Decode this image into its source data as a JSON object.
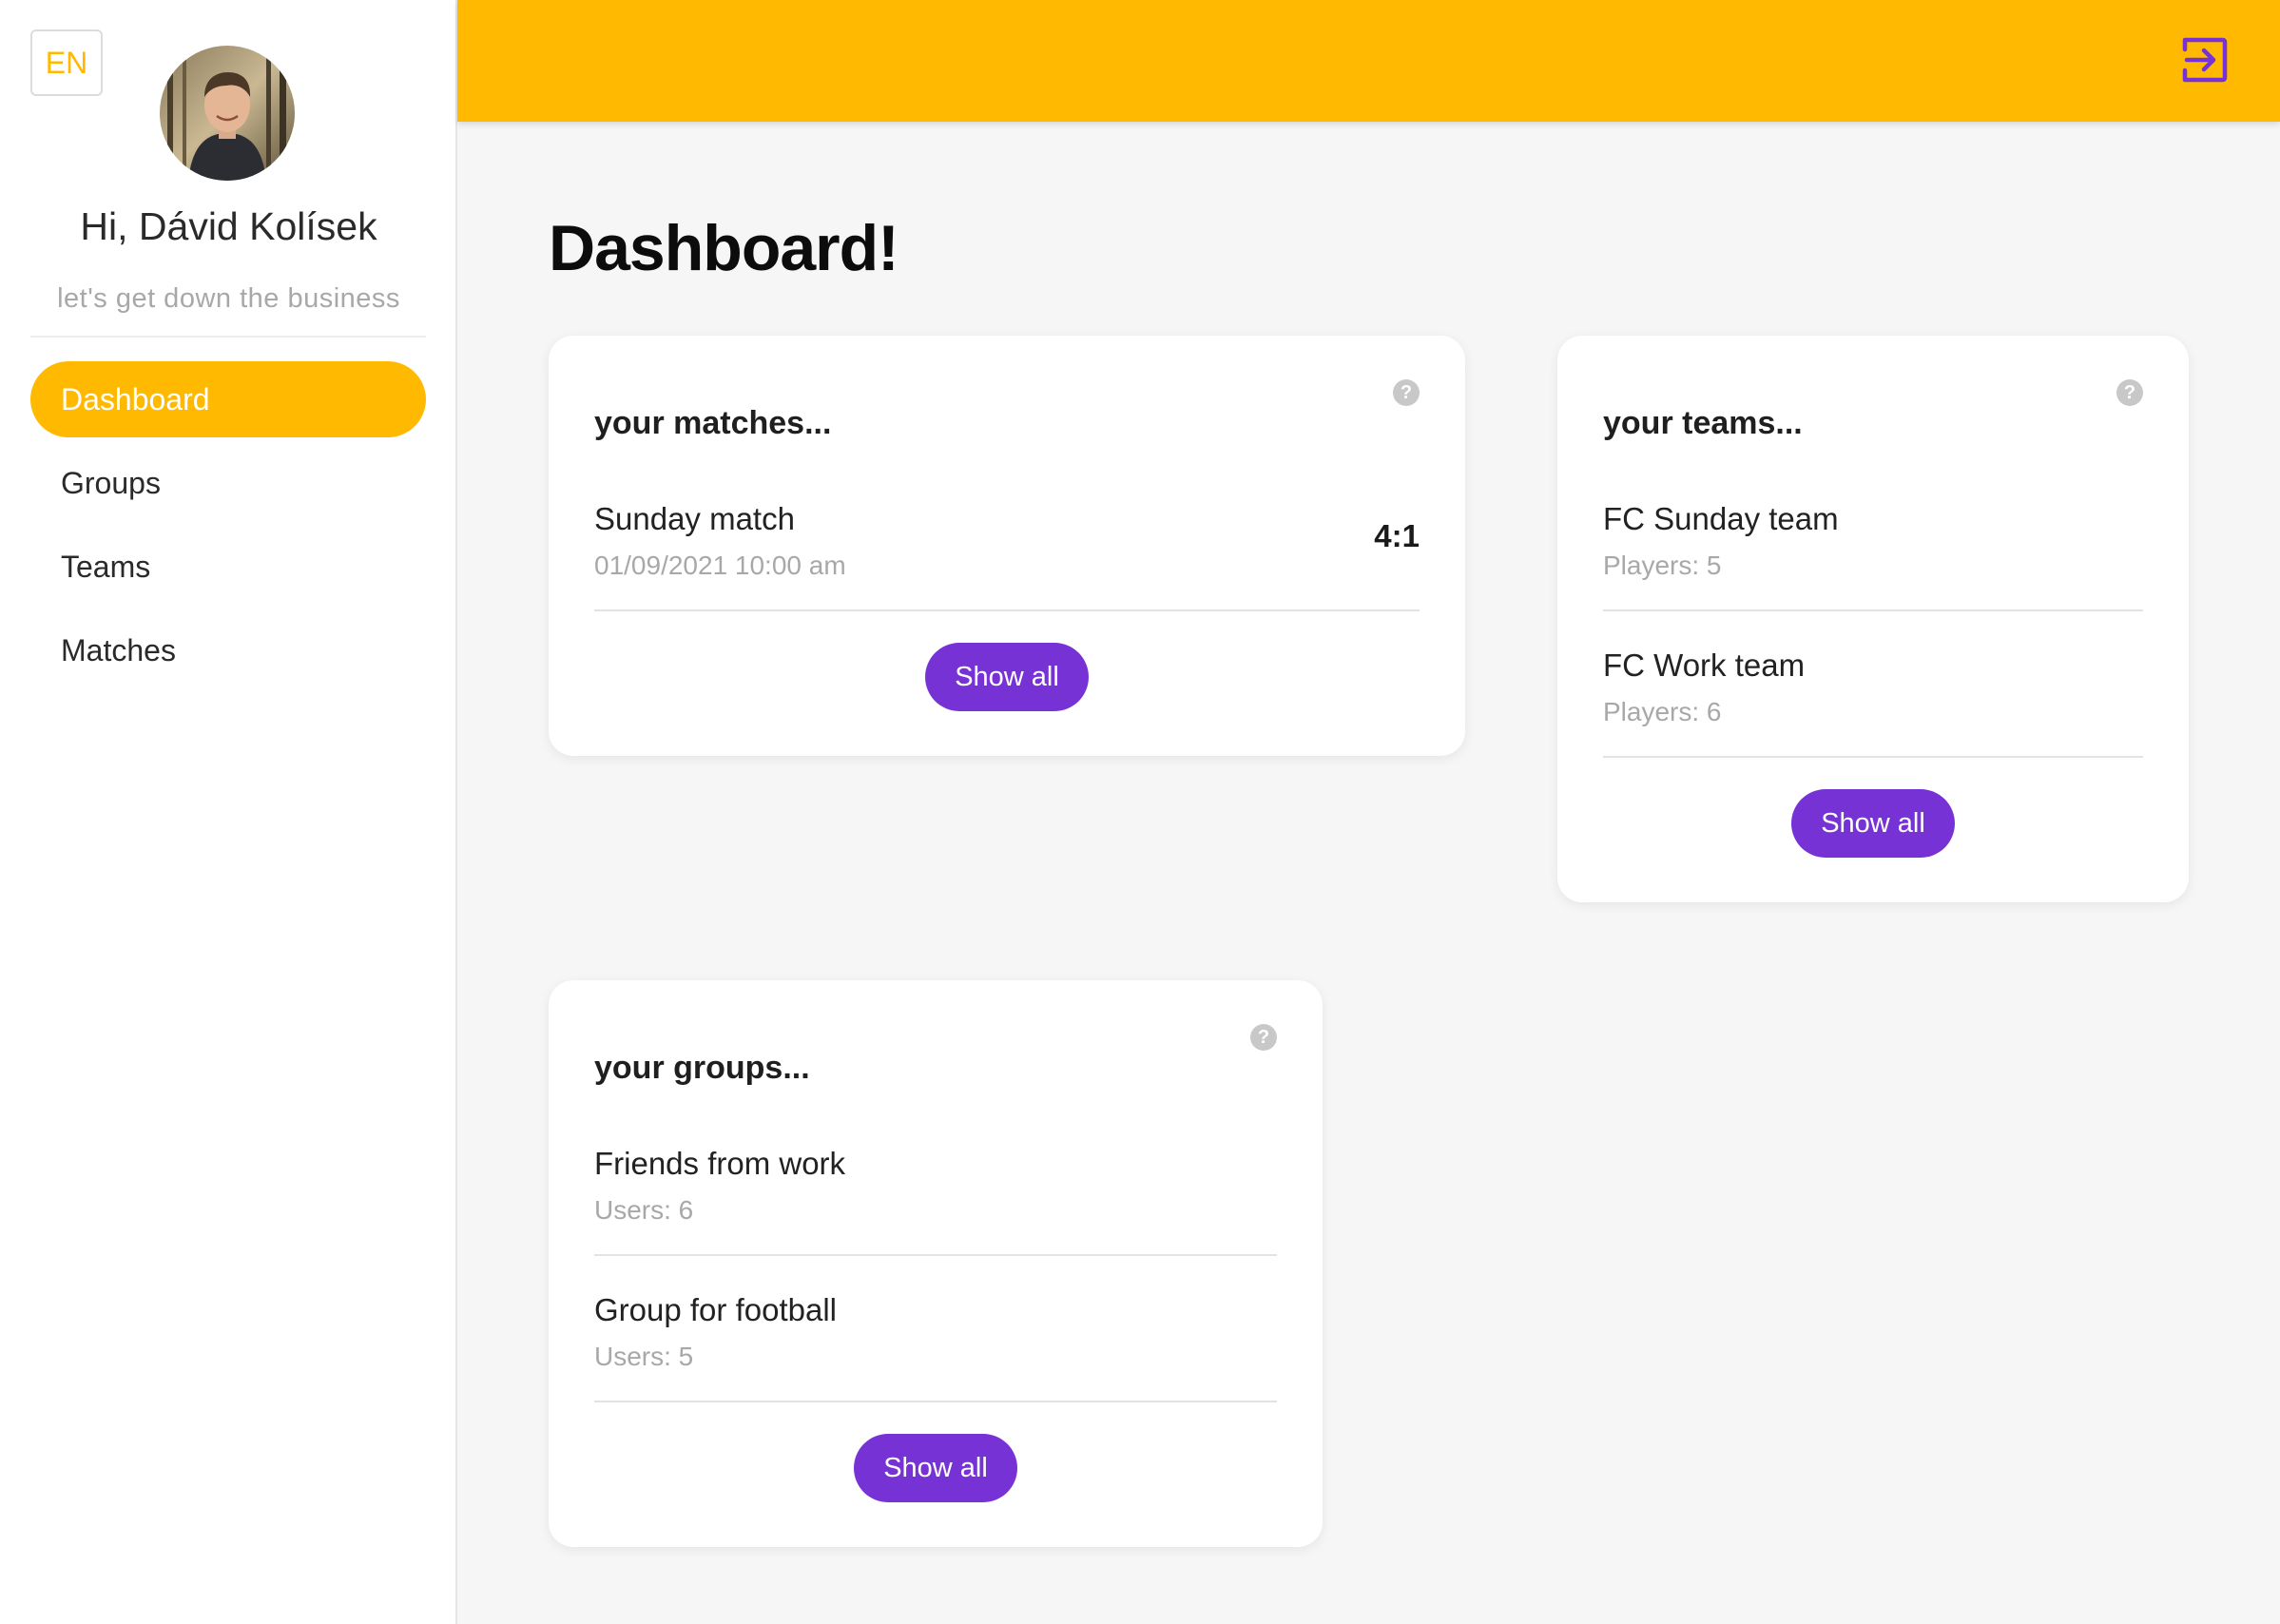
{
  "sidebar": {
    "language": "EN",
    "greeting": "Hi, Dávid Kolísek",
    "tagline": "let's get down the business",
    "nav": [
      {
        "label": "Dashboard",
        "active": true
      },
      {
        "label": "Groups",
        "active": false
      },
      {
        "label": "Teams",
        "active": false
      },
      {
        "label": "Matches",
        "active": false
      }
    ]
  },
  "topbar": {
    "logout_icon": "logout-icon"
  },
  "main": {
    "title": "Dashboard!",
    "matches": {
      "title": "your matches...",
      "items": [
        {
          "name": "Sunday match",
          "date": "01/09/2021 10:00 am",
          "score": "4:1"
        }
      ],
      "button": "Show all"
    },
    "teams": {
      "title": "your teams...",
      "items": [
        {
          "name": "FC Sunday team",
          "players": "Players: 5"
        },
        {
          "name": "FC Work team",
          "players": "Players: 6"
        }
      ],
      "button": "Show all"
    },
    "groups": {
      "title": "your groups...",
      "items": [
        {
          "name": "Friends from work",
          "users": "Users: 6"
        },
        {
          "name": "Group for football",
          "users": "Users: 5"
        }
      ],
      "button": "Show all"
    }
  },
  "colors": {
    "accent": "#ffb900",
    "primary": "#7732d6",
    "background": "#f6f6f6"
  }
}
